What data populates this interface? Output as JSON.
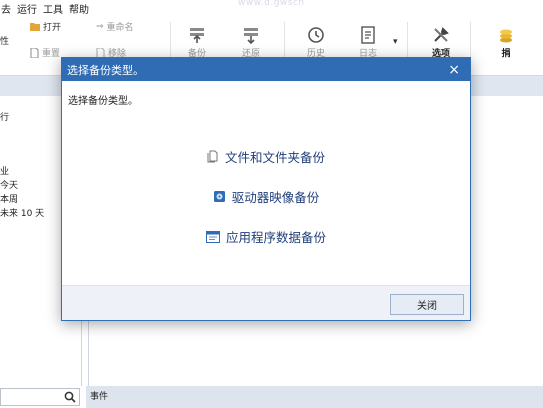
{
  "menu": {
    "items": [
      "去",
      "运行",
      "工具",
      "帮助"
    ]
  },
  "watermark": "www.d.gwscn",
  "ribbon": {
    "small": {
      "file_attr": "性",
      "open": "打开",
      "rename": "重命名",
      "reset": "重置",
      "delete": "移除"
    },
    "big": {
      "backup": "备份",
      "restore": "还原",
      "history": "历史",
      "log": "日志",
      "options": "选项",
      "donate": "捐"
    }
  },
  "left_pane": {
    "items": [
      "行",
      "业",
      "今天",
      "本周",
      "未来 10 天"
    ]
  },
  "events_label": "事件",
  "dialog": {
    "title": "选择备份类型。",
    "prompt": "选择备份类型。",
    "options": [
      "文件和文件夹备份",
      "驱动器映像备份",
      "应用程序数据备份"
    ],
    "close_button": "关闭",
    "close_glyph": "×"
  },
  "colors": {
    "titlebar": "#2f6cb3",
    "option_text": "#1f3f7a",
    "pane_bg": "#dfe6f0"
  }
}
